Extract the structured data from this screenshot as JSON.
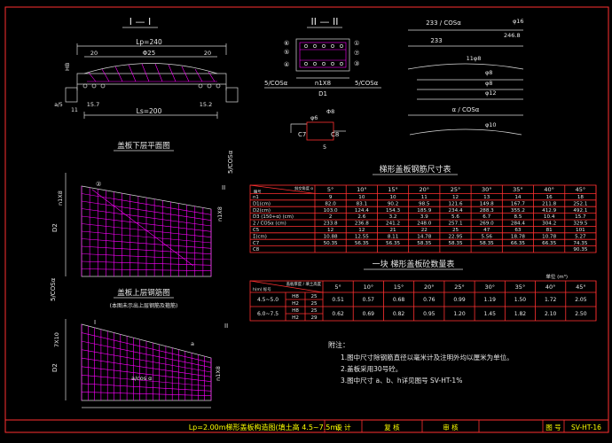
{
  "colors": {
    "background": "#000000",
    "lines": "#d8d8d8",
    "rebar": "#ff00ff",
    "title_text": "#ffff00",
    "border": "#ff3030",
    "table_grid": "#ff3030"
  },
  "section1": {
    "title": "I — I",
    "lp": "Lp=240",
    "d1": "Φ25",
    "hb": "HB",
    "ls": "Ls=200",
    "a1": "20",
    "a2": "20",
    "b1": "15.7",
    "b2": "15.2",
    "c": "11",
    "a": "a/5"
  },
  "section2": {
    "title": "II — II",
    "n": "n1X8",
    "d1": "D1",
    "cos_left": "5/COSα",
    "cos_right": "5/COSα",
    "marks": [
      "①",
      "②",
      "③",
      "④",
      "⑤",
      "⑥",
      "⑦",
      "⑧"
    ],
    "bar_labels": [
      "φ6",
      "C7",
      "C8",
      "Φ8"
    ],
    "five": "5"
  },
  "rebar_detail": {
    "l1": "233 / COSα",
    "l2": "233",
    "phi16": "φ16",
    "s246": "246.8",
    "l3": "11φ8",
    "phi8a": "φ8",
    "phi8b": "φ8",
    "phi12": "φ12",
    "acos": "α / COSα",
    "phi10": "φ10",
    "ok": "⑤",
    "n2": "⑦",
    "n3": "⑧",
    "n4": "⑩",
    "n5": "⑪"
  },
  "plan_lower": {
    "title": "盖板下层平面图",
    "cos": "5/COSα",
    "d2": "D2",
    "nx": "n1X8",
    "n2x": "n1X8",
    "roman": "II",
    "mark": "②"
  },
  "plan_upper": {
    "title": "盖板上层钢筋图",
    "note": "(本图未示出上层钢筋及箍筋)",
    "cos": "5/COSα",
    "d2": "D2",
    "roman1": "I",
    "roman2": "II",
    "a": "a",
    "dim": "a/cos α",
    "n7": "7X10",
    "n8": "n1X8"
  },
  "table1": {
    "title": "梯形盖板钢筋尺寸表",
    "corner_top": "斜交角度 α",
    "corner_bottom": "编号",
    "angles": [
      "5°",
      "10°",
      "15°",
      "20°",
      "25°",
      "30°",
      "35°",
      "40°",
      "45°"
    ],
    "rows": [
      {
        "label": "n1",
        "vals": [
          "9",
          "10",
          "10",
          "11",
          "12",
          "13",
          "14",
          "16",
          "18"
        ]
      },
      {
        "label": "D1(cm)",
        "vals": [
          "82.0",
          "83.1",
          "90.2",
          "98.5",
          "121.6",
          "149.8",
          "167.7",
          "211.8",
          "252.1"
        ]
      },
      {
        "label": "D2(cm)",
        "vals": [
          "103.0",
          "124.4",
          "154.3",
          "185.9",
          "234.4",
          "288.3",
          "355.2",
          "412.9",
          "492.1"
        ]
      },
      {
        "label": "D3 (150+α) (cm)",
        "vals": [
          "2",
          "2.6",
          "3.2",
          "3.9",
          "5.6",
          "6.7",
          "8.5",
          "10.4",
          "15.7"
        ]
      },
      {
        "label": "2 / COSα (cm)",
        "vals": [
          "233.8",
          "236.8",
          "241.2",
          "248.0",
          "257.1",
          "269.0",
          "284.4",
          "304.2",
          "329.5"
        ]
      },
      {
        "label": "C5",
        "vals": [
          "12",
          "12",
          "21",
          "22",
          "25",
          "47",
          "63",
          "81",
          "101"
        ]
      },
      {
        "label": "Σ(cm)",
        "vals": [
          "10.88",
          "12.55",
          "8.11",
          "14.78",
          "22.95",
          "5.56",
          "18.78",
          "10.78",
          "5.27"
        ]
      },
      {
        "label": "C7",
        "vals": [
          "50.35",
          "56.35",
          "56.35",
          "58.35",
          "58.35",
          "58.35",
          "66.35",
          "66.35",
          "74.35"
        ]
      },
      {
        "label": "C8",
        "vals": [
          "",
          "",
          "",
          "",
          "",
          "",
          "",
          "",
          "90.35"
        ]
      }
    ]
  },
  "table2": {
    "title": "一块 梯形盖板砼数量表",
    "unit": "单位 (m³)",
    "corner_top": "盖板厚度 / 填土高度",
    "corner_bottom": "h(m)    标号",
    "angles": [
      "5°",
      "10°",
      "15°",
      "20°",
      "25°",
      "30°",
      "35°",
      "40°",
      "45°"
    ],
    "rows": [
      {
        "range": "4.5~5.0",
        "sub": "H8",
        "grade": "25",
        "vals": [
          "0.51",
          "0.57",
          "0.68",
          "0.76",
          "0.99",
          "1.19",
          "1.50",
          "1.72",
          "2.05"
        ]
      },
      {
        "range": "",
        "sub": "H2",
        "grade": "25",
        "vals": [
          "",
          "",
          "",
          "",
          "",
          "",
          "",
          "",
          ""
        ]
      },
      {
        "range": "6.0~7.5",
        "sub": "H8",
        "grade": "25",
        "vals": [
          "0.62",
          "0.69",
          "0.82",
          "0.95",
          "1.20",
          "1.45",
          "1.82",
          "2.10",
          "2.50"
        ]
      },
      {
        "range": "",
        "sub": "H2",
        "grade": "29",
        "vals": [
          "",
          "",
          "",
          "",
          "",
          "",
          "",
          "",
          ""
        ]
      }
    ]
  },
  "notes": {
    "heading": "附注：",
    "items": [
      "1.图中尺寸除钢筋直径以毫米计及注明外均以厘米为单位。",
      "2.盖板采用30号砼。",
      "3.图中尺寸 a、b、h详见图号 SV-HT-1%"
    ]
  },
  "title_block": {
    "title": "Lp=2.00m梯形盖板构造图(填土高 4.5~7.5m)",
    "design": "设 计",
    "review": "复 核",
    "check": "审 核",
    "figno_label": "图 号",
    "figno": "SV-HT-16"
  }
}
